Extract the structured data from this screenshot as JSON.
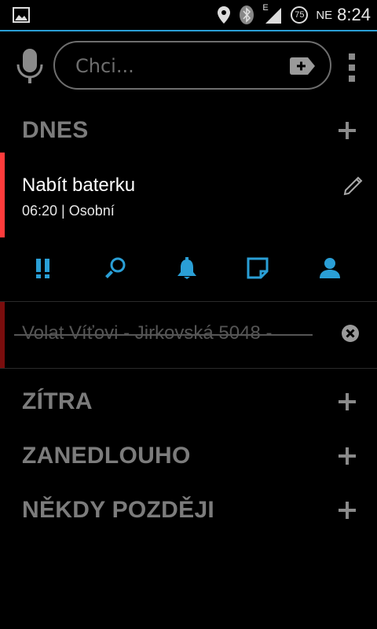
{
  "status": {
    "network_label": "NE",
    "time": "8:24",
    "signal_type": "E",
    "badge": "75"
  },
  "search": {
    "placeholder": "Chci..."
  },
  "sections": {
    "today": "DNES",
    "tomorrow": "ZÍTRA",
    "soon": "ZANEDLOUHO",
    "later": "NĚKDY POZDĚJI"
  },
  "tasks": [
    {
      "title": "Nabít baterku",
      "meta": "06:20 | Osobní",
      "priority_color": "#ff3b3b"
    },
    {
      "title": "Volat Víťovi - Jirkovská 5048 -",
      "done": true,
      "priority_color": "#7a0d0d"
    }
  ],
  "task_actions": [
    "priority-icon",
    "search-icon",
    "bell-icon",
    "note-icon",
    "contact-icon"
  ],
  "colors": {
    "accent": "#2a9fd6",
    "section": "#7c7c7c"
  }
}
